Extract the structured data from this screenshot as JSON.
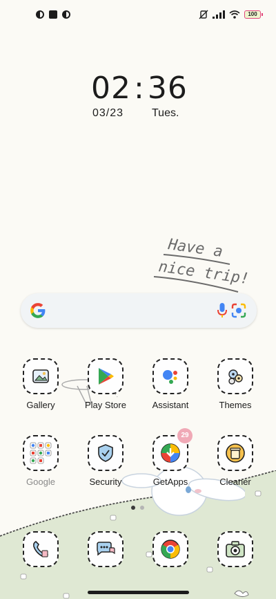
{
  "status_bar": {
    "left_icons": [
      "app-notification-icon",
      "square-notification-icon",
      "app-notification-icon"
    ],
    "right_icons": [
      "mute-vibrate-icon",
      "signal-icon",
      "wifi-icon"
    ],
    "battery": "100"
  },
  "clock": {
    "hours": "02",
    "separator": ":",
    "minutes": "36",
    "date": "03/23",
    "day": "Tues."
  },
  "wallpaper": {
    "text_line1": "Have a",
    "text_line2": "nice trip!"
  },
  "search_bar": {
    "icons": [
      "google-g-icon",
      "microphone-icon",
      "google-lens-icon"
    ]
  },
  "apps_row1": [
    {
      "label": "Gallery",
      "icon": "gallery-icon"
    },
    {
      "label": "Play Store",
      "icon": "play-store-icon"
    },
    {
      "label": "Assistant",
      "icon": "assistant-icon"
    },
    {
      "label": "Themes",
      "icon": "themes-icon"
    }
  ],
  "apps_row2": [
    {
      "label": "Google",
      "icon": "google-folder-icon"
    },
    {
      "label": "Security",
      "icon": "security-shield-icon"
    },
    {
      "label": "GetApps",
      "icon": "getapps-icon",
      "badge": "29"
    },
    {
      "label": "Cleaner",
      "icon": "cleaner-icon"
    }
  ],
  "dock": [
    {
      "icon": "phone-icon"
    },
    {
      "icon": "messages-icon"
    },
    {
      "icon": "chrome-icon"
    },
    {
      "icon": "camera-icon"
    }
  ],
  "page_indicator": {
    "count": 2,
    "active": 1
  },
  "colors": {
    "background": "#fbfaf5",
    "hill": "#dfe8d3",
    "badge": "#f0a9b6",
    "google_blue": "#4285f4",
    "google_red": "#ea4335",
    "google_yellow": "#fbbc05",
    "google_green": "#34a853"
  }
}
